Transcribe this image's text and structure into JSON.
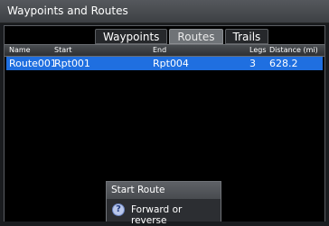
{
  "window": {
    "title": "Waypoints and Routes"
  },
  "tabs": [
    {
      "label": "Waypoints",
      "active": false
    },
    {
      "label": "Routes",
      "active": true
    },
    {
      "label": "Trails",
      "active": false
    }
  ],
  "table": {
    "columns": [
      "Name",
      "Start",
      "End",
      "Legs",
      "Distance (mi)"
    ],
    "rows": [
      {
        "name": "Route001",
        "start": "Rpt001",
        "end": "Rpt004",
        "legs": "3",
        "distance": "628.2",
        "selected": true
      }
    ]
  },
  "popup": {
    "title": "Start Route",
    "items": [
      {
        "icon": "question-icon",
        "label": "Forward or reverse"
      }
    ]
  },
  "colors": {
    "selection": "#1f6fe0",
    "background": "#000000",
    "titlebar": "#4a4d51"
  }
}
